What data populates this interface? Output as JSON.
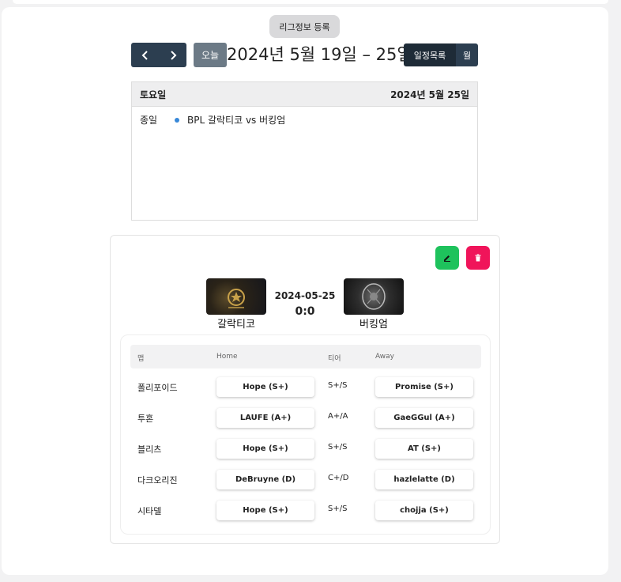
{
  "toolbar": {
    "league_button": "리그정보 등록",
    "today_label": "오늘",
    "title": "2024년 5월 19일 – 25일",
    "view_list": "일정목록",
    "view_month": "월"
  },
  "list": {
    "day_label": "토요일",
    "date_label": "2024년 5월 25일",
    "events": [
      {
        "time": "종일",
        "title": "BPL 갈락티코 vs 버킹엄",
        "color": "#3788d8"
      }
    ]
  },
  "match": {
    "home_team": "갈락티코",
    "away_team": "버킹엄",
    "date": "2024-05-25",
    "score": "0:0",
    "edit_color": "#1ec25c",
    "delete_color": "#f0145a"
  },
  "lineup": {
    "headers": {
      "map": "맵",
      "home": "Home",
      "tier": "티어",
      "away": "Away"
    },
    "rows": [
      {
        "map": "폴리포이드",
        "home": "Hope (S+)",
        "tier": "S+/S",
        "away": "Promise (S+)"
      },
      {
        "map": "투혼",
        "home": "LAUFE (A+)",
        "tier": "A+/A",
        "away": "GaeGGul (A+)"
      },
      {
        "map": "블리츠",
        "home": "Hope (S+)",
        "tier": "S+/S",
        "away": "AT (S+)"
      },
      {
        "map": "다크오리진",
        "home": "DeBruyne (D)",
        "tier": "C+/D",
        "away": "hazlelatte (D)"
      },
      {
        "map": "시타델",
        "home": "Hope (S+)",
        "tier": "S+/S",
        "away": "chojja (S+)"
      }
    ]
  }
}
